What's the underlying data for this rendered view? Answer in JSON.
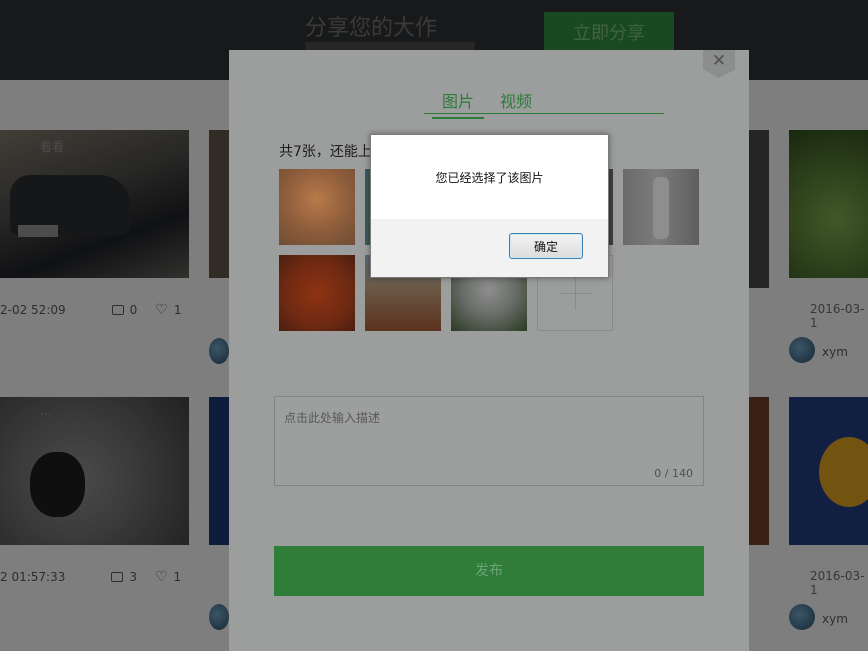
{
  "header": {
    "title": "分享您的大作",
    "share_button": "立即分享"
  },
  "cards": [
    {
      "caption": "看看",
      "time": "2-02 52:09",
      "comments": "0",
      "likes": "1"
    },
    {
      "caption": "...",
      "time": "2 01:57:33",
      "comments": "3",
      "likes": "1"
    },
    {
      "time": "2016-03-1",
      "user": "xym"
    },
    {
      "time": "2016-03-1",
      "user": "xym"
    }
  ],
  "modal": {
    "close_label": "✕",
    "tabs": [
      "图片",
      "视频"
    ],
    "count_text": "共7张，还能上",
    "description_placeholder": "点击此处输入描述",
    "char_count": "0 / 140",
    "publish_label": "发布"
  },
  "alert": {
    "message": "您已经选择了该图片",
    "ok_label": "确定"
  }
}
